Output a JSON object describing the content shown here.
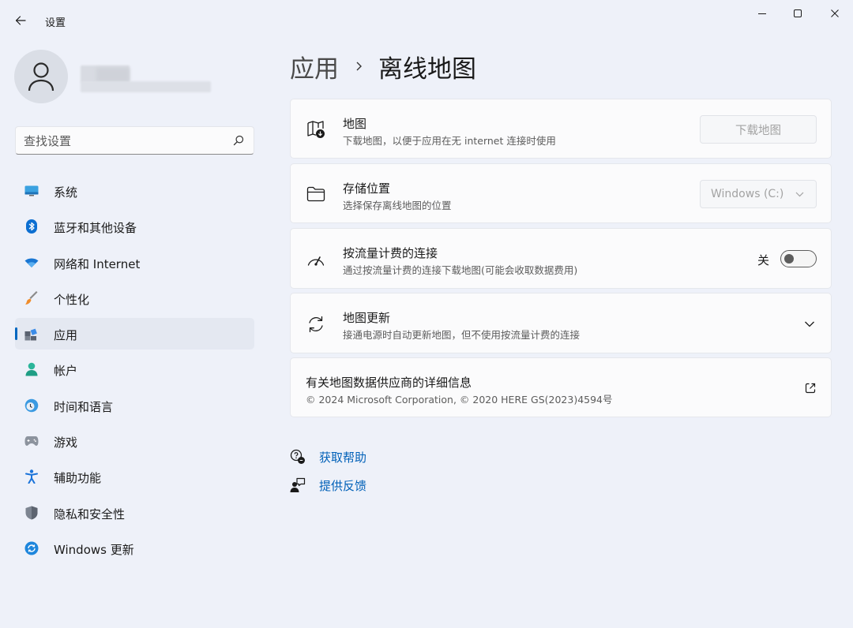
{
  "window": {
    "title": "设置"
  },
  "search": {
    "placeholder": "查找设置"
  },
  "sidebar": {
    "items": [
      {
        "label": "系统",
        "icon": "monitor-icon"
      },
      {
        "label": "蓝牙和其他设备",
        "icon": "bluetooth-icon"
      },
      {
        "label": "网络和 Internet",
        "icon": "wifi-icon"
      },
      {
        "label": "个性化",
        "icon": "brush-icon"
      },
      {
        "label": "应用",
        "icon": "apps-icon",
        "selected": true
      },
      {
        "label": "帐户",
        "icon": "person-icon"
      },
      {
        "label": "时间和语言",
        "icon": "clock-globe-icon"
      },
      {
        "label": "游戏",
        "icon": "gamepad-icon"
      },
      {
        "label": "辅助功能",
        "icon": "accessibility-icon"
      },
      {
        "label": "隐私和安全性",
        "icon": "shield-icon"
      },
      {
        "label": "Windows 更新",
        "icon": "update-icon"
      }
    ]
  },
  "breadcrumb": {
    "parent": "应用",
    "current": "离线地图"
  },
  "cards": {
    "maps": {
      "title": "地图",
      "desc": "下载地图，以便于应用在无 internet 连接时使用",
      "button": "下载地图"
    },
    "storage": {
      "title": "存储位置",
      "desc": "选择保存离线地图的位置",
      "select_value": "Windows (C:)"
    },
    "metered": {
      "title": "按流量计费的连接",
      "desc": "通过按流量计费的连接下载地图(可能会收取数据费用)",
      "toggle_label": "关",
      "toggle_on": false
    },
    "updates": {
      "title": "地图更新",
      "desc": "接通电源时自动更新地图，但不使用按流量计费的连接"
    },
    "provider": {
      "title": "有关地图数据供应商的详细信息",
      "desc": "© 2024 Microsoft Corporation, © 2020 HERE GS(2023)4594号"
    }
  },
  "links": {
    "help": "获取帮助",
    "feedback": "提供反馈"
  },
  "colors": {
    "accent": "#0067c0",
    "link": "#0060b8",
    "background": "#eef1f9",
    "card": "#fbfbfc"
  }
}
